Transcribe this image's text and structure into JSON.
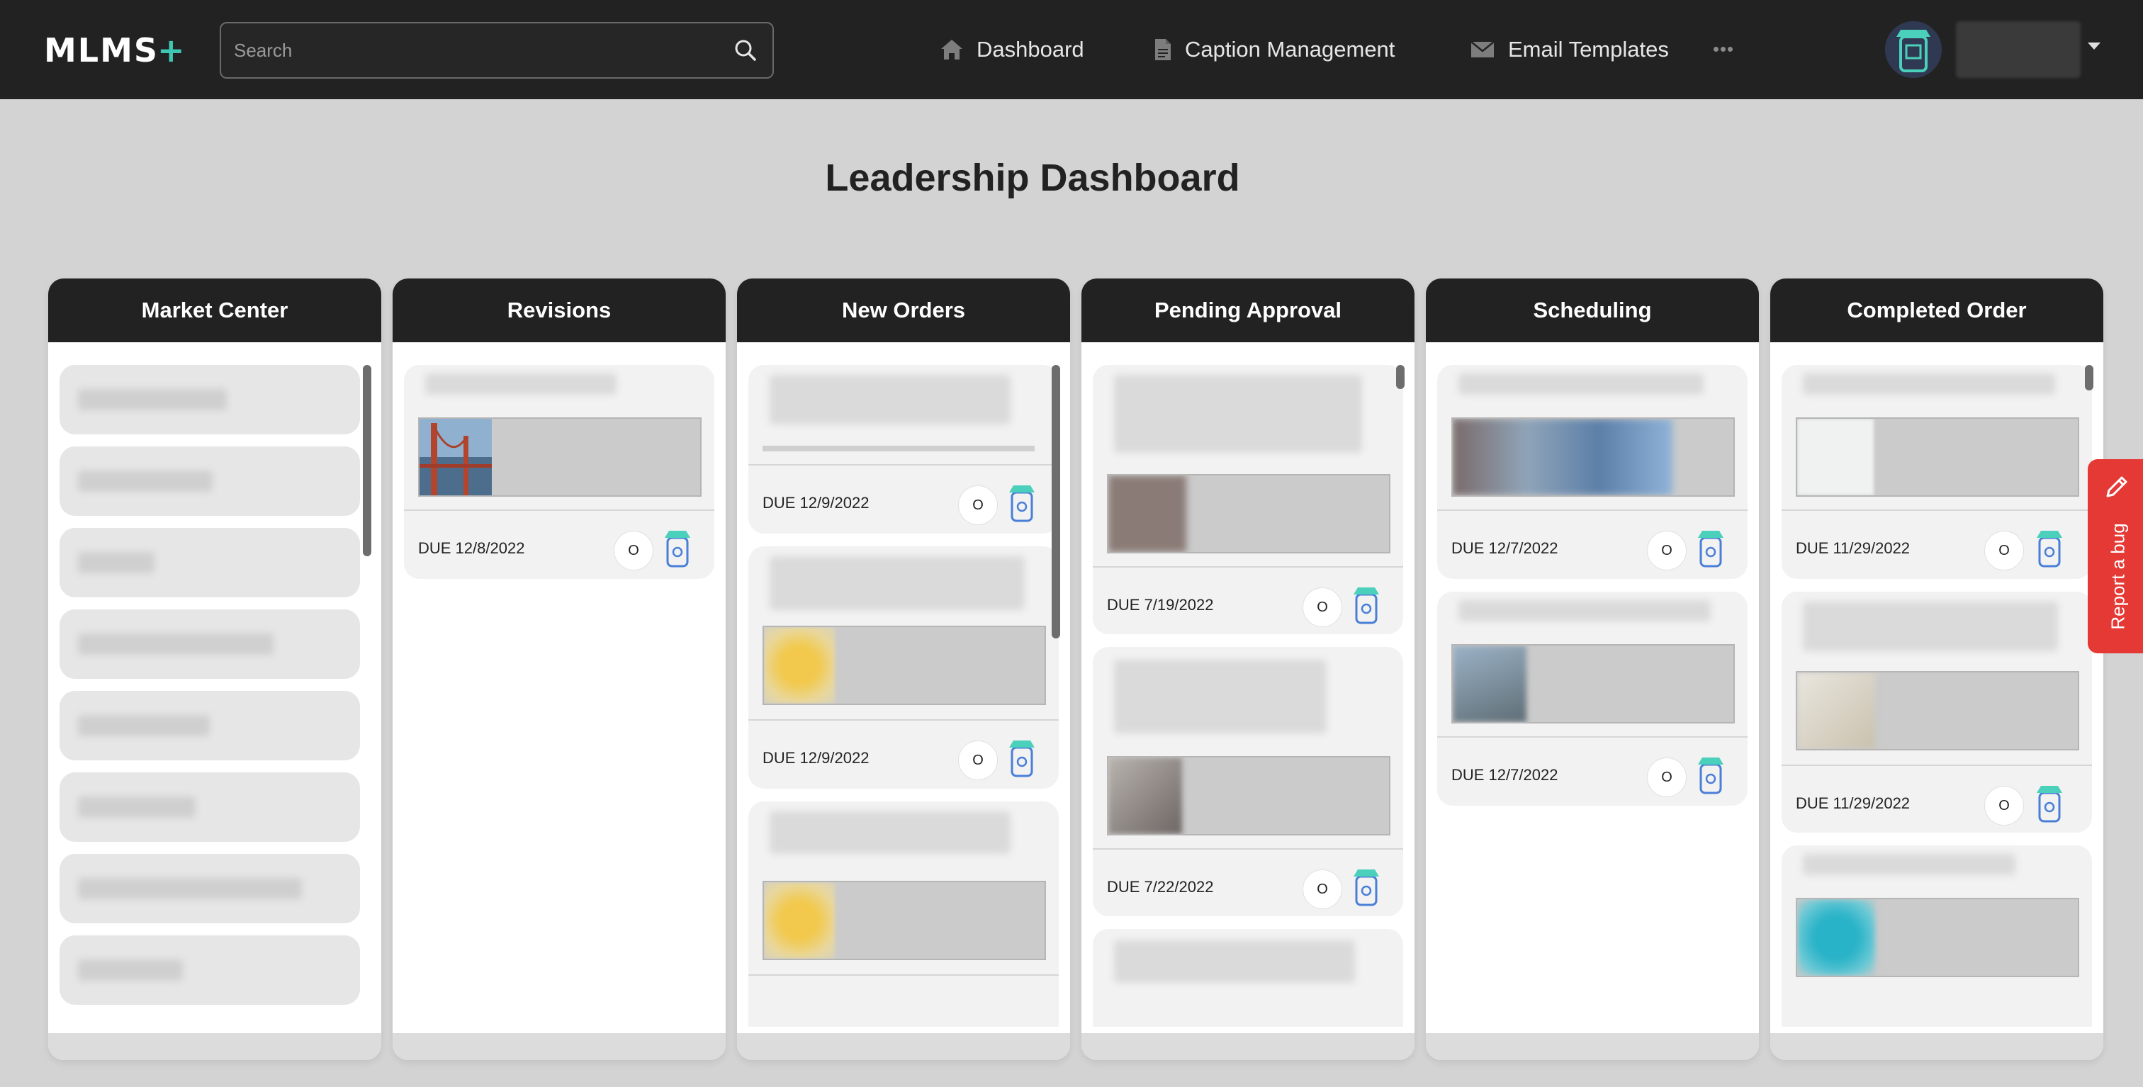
{
  "app": {
    "logo_text": "MLMS",
    "logo_plus": "+"
  },
  "search": {
    "placeholder": "Search"
  },
  "nav": {
    "dashboard": "Dashboard",
    "caption_management": "Caption Management",
    "email_templates": "Email Templates"
  },
  "page": {
    "title": "Leadership Dashboard"
  },
  "columns": [
    {
      "title": "Market Center"
    },
    {
      "title": "Revisions"
    },
    {
      "title": "New Orders"
    },
    {
      "title": "Pending Approval"
    },
    {
      "title": "Scheduling"
    },
    {
      "title": "Completed Order"
    }
  ],
  "cards": {
    "revisions": [
      {
        "due": "DUE 12/8/2022",
        "status": "O"
      }
    ],
    "new_orders": [
      {
        "due": "DUE 12/9/2022",
        "status": "O"
      },
      {
        "due": "DUE 12/9/2022",
        "status": "O"
      }
    ],
    "pending_approval": [
      {
        "due": "DUE 7/19/2022",
        "status": "O"
      },
      {
        "due": "DUE 7/22/2022",
        "status": "O"
      }
    ],
    "scheduling": [
      {
        "due": "DUE 12/7/2022",
        "status": "O"
      },
      {
        "due": "DUE 12/7/2022",
        "status": "O"
      }
    ],
    "completed": [
      {
        "due": "DUE 11/29/2022",
        "status": "O"
      },
      {
        "due": "DUE 11/29/2022",
        "status": "O"
      }
    ]
  },
  "report_bug": {
    "label": "Report a bug"
  },
  "colors": {
    "topbar": "#222222",
    "accent": "#3ec8b4",
    "report_bug": "#e53935",
    "background": "#d3d3d3"
  }
}
